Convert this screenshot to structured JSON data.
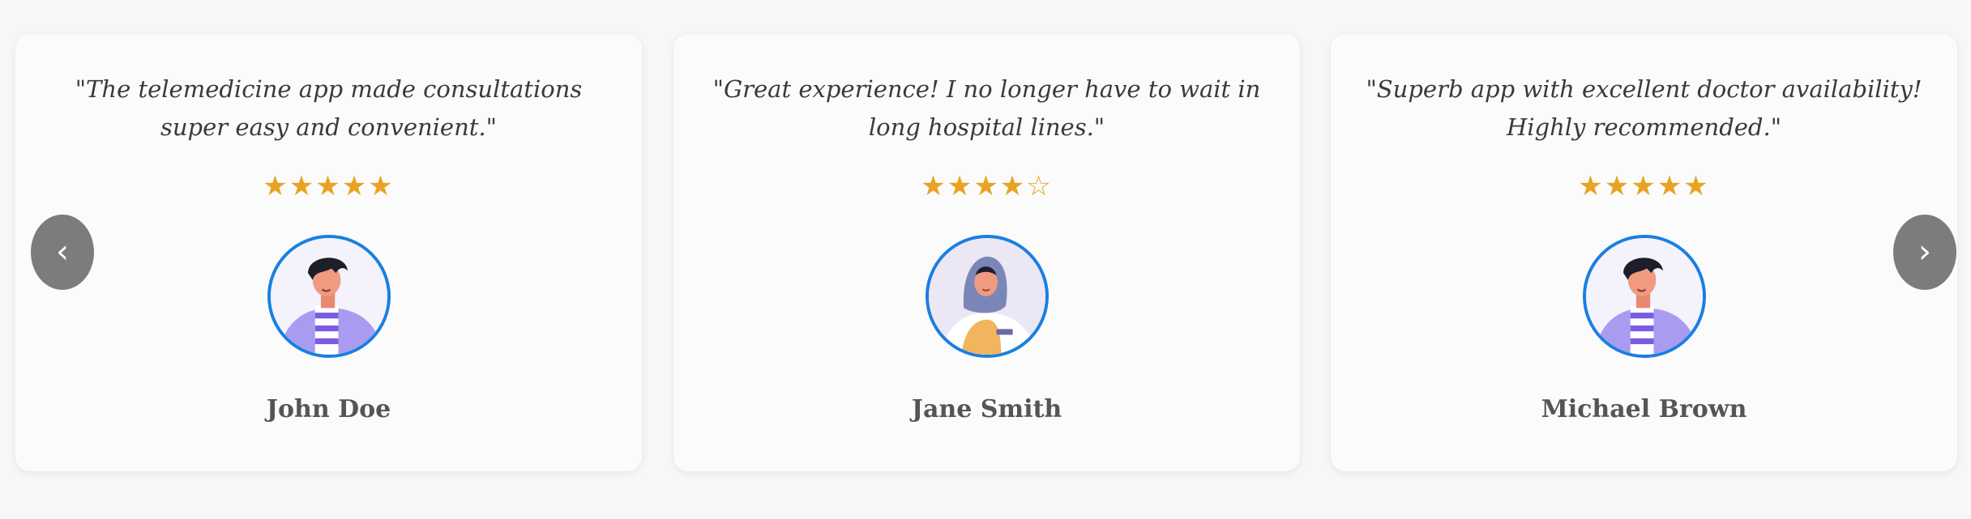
{
  "carousel": {
    "prev_label": "‹",
    "next_label": "›",
    "accent_star": "#e8a323",
    "avatar_border": "#1a7fe0",
    "testimonials": [
      {
        "quote": "\"The telemedicine app made consultations super easy and convenient.\"",
        "stars": "★★★★★",
        "rating": 5,
        "name": "John Doe",
        "avatar": "man-avatar-icon"
      },
      {
        "quote": "\"Great experience! I no longer have to wait in long hospital lines.\"",
        "stars": "★★★★☆",
        "rating": 4,
        "name": "Jane Smith",
        "avatar": "woman-doctor-avatar-icon"
      },
      {
        "quote": "\"Superb app with excellent doctor availability! Highly recommended.\"",
        "stars": "★★★★★",
        "rating": 5,
        "name": "Michael Brown",
        "avatar": "man-avatar-icon"
      }
    ]
  }
}
